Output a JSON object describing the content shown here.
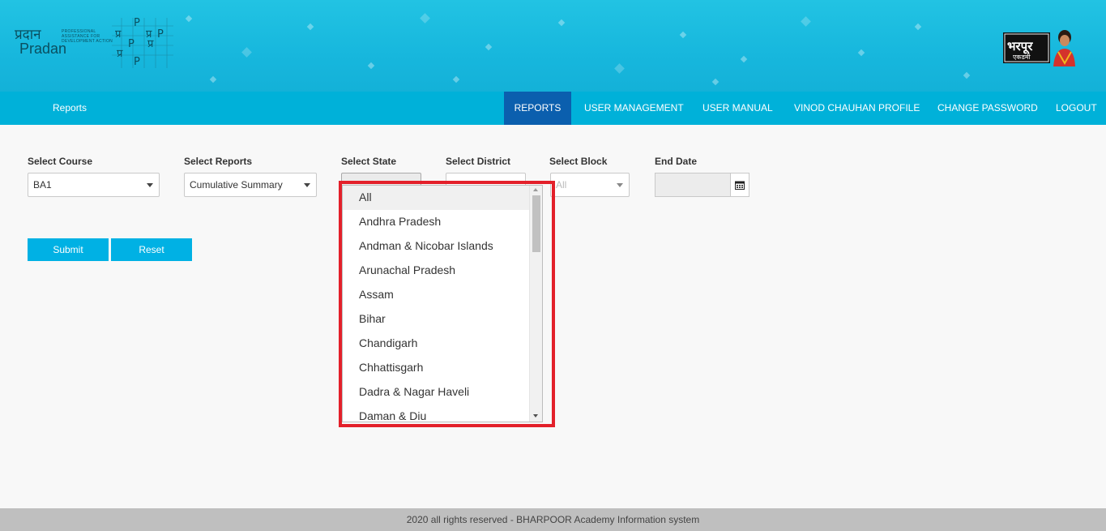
{
  "header": {
    "pradan_logo_text": "Pradan",
    "pradan_logo_hindi": "प्रदान",
    "pradan_tagline": "PROFESSIONAL ASSISTANCE FOR DEVELOPMENT ACTION",
    "prp_letters": [
      "प्र",
      "P",
      "प्र",
      "P",
      "प्र",
      "P",
      "प्र",
      "P"
    ],
    "bharpoor_logo_text": "भरपूर",
    "bharpoor_logo_sub": "एकडमी"
  },
  "nav": {
    "brand": "Reports",
    "items": [
      {
        "label": "REPORTS",
        "active": true
      },
      {
        "label": "USER MANAGEMENT",
        "active": false
      },
      {
        "label": "USER MANUAL",
        "active": false
      },
      {
        "label": "VINOD CHAUHAN PROFILE",
        "active": false
      },
      {
        "label": "CHANGE PASSWORD",
        "active": false
      },
      {
        "label": "LOGOUT",
        "active": false
      }
    ]
  },
  "form": {
    "course": {
      "label": "Select Course",
      "value": "BA1"
    },
    "reports": {
      "label": "Select Reports",
      "value": "Cumulative Summary"
    },
    "state": {
      "label": "Select State",
      "value": ""
    },
    "district": {
      "label": "Select District",
      "value": ""
    },
    "block": {
      "label": "Select Block",
      "value": "All"
    },
    "end_date": {
      "label": "End Date",
      "value": ""
    },
    "submit_label": "Submit",
    "reset_label": "Reset"
  },
  "state_dropdown": {
    "options": [
      "All",
      "Andhra Pradesh",
      "Andman & Nicobar Islands",
      "Arunachal Pradesh",
      "Assam",
      "Bihar",
      "Chandigarh",
      "Chhattisgarh",
      "Dadra & Nagar Haveli",
      "Daman & Diu"
    ],
    "selected_index": 0
  },
  "footer": {
    "text": "2020 all rights reserved - BHARPOOR Academy Information system"
  },
  "colors": {
    "banner": "#17b7dd",
    "navbar": "#00b1d9",
    "nav_active": "#0b5fae",
    "button": "#00b1e4",
    "highlight": "#e3202a",
    "footer": "#bfbfbf"
  }
}
